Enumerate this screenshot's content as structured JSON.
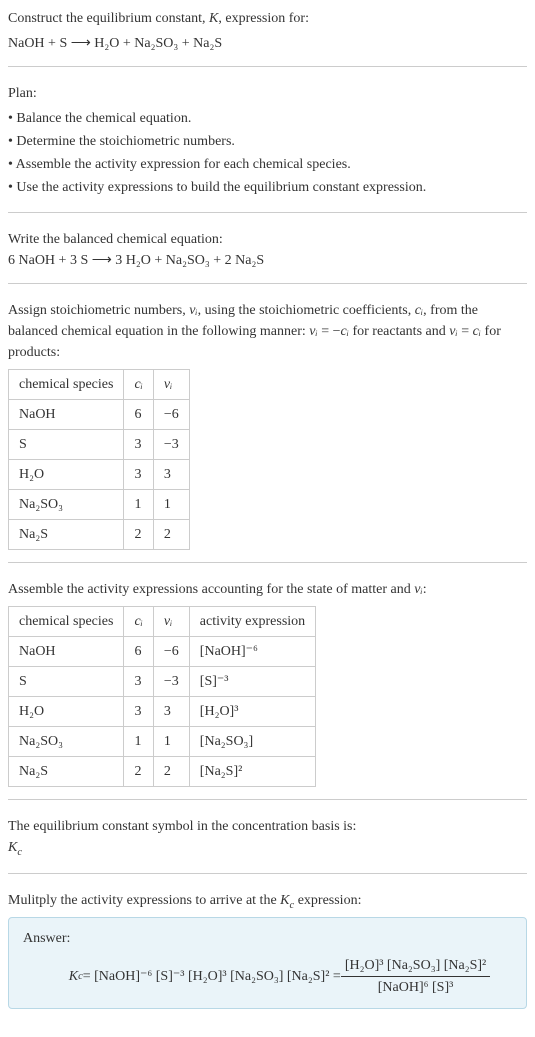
{
  "intro": {
    "line1": "Construct the equilibrium constant, ",
    "K": "K",
    "line1b": ", expression for:",
    "equation": "NaOH + S ⟶ H₂O + Na₂SO₃ + Na₂S"
  },
  "plan": {
    "title": "Plan:",
    "items": [
      "• Balance the chemical equation.",
      "• Determine the stoichiometric numbers.",
      "• Assemble the activity expression for each chemical species.",
      "• Use the activity expressions to build the equilibrium constant expression."
    ]
  },
  "balanced": {
    "title": "Write the balanced chemical equation:",
    "equation": "6 NaOH + 3 S ⟶ 3 H₂O + Na₂SO₃ + 2 Na₂S"
  },
  "stoich": {
    "intro1": "Assign stoichiometric numbers, ",
    "nu": "νᵢ",
    "intro2": ", using the stoichiometric coefficients, ",
    "ci": "cᵢ",
    "intro3": ", from the balanced chemical equation in the following manner: ",
    "rule1a": "νᵢ",
    "rule1b": " = −",
    "rule1c": "cᵢ",
    "intro4": " for reactants and ",
    "rule2a": "νᵢ",
    "rule2b": " = ",
    "rule2c": "cᵢ",
    "intro5": " for products:",
    "headers": [
      "chemical species",
      "cᵢ",
      "νᵢ"
    ],
    "rows": [
      {
        "species": "NaOH",
        "c": "6",
        "v": "−6"
      },
      {
        "species": "S",
        "c": "3",
        "v": "−3"
      },
      {
        "species": "H₂O",
        "c": "3",
        "v": "3"
      },
      {
        "species": "Na₂SO₃",
        "c": "1",
        "v": "1"
      },
      {
        "species": "Na₂S",
        "c": "2",
        "v": "2"
      }
    ]
  },
  "activity": {
    "intro1": "Assemble the activity expressions accounting for the state of matter and ",
    "nu": "νᵢ",
    "intro2": ":",
    "headers": [
      "chemical species",
      "cᵢ",
      "νᵢ",
      "activity expression"
    ],
    "rows": [
      {
        "species": "NaOH",
        "c": "6",
        "v": "−6",
        "expr": "[NaOH]⁻⁶"
      },
      {
        "species": "S",
        "c": "3",
        "v": "−3",
        "expr": "[S]⁻³"
      },
      {
        "species": "H₂O",
        "c": "3",
        "v": "3",
        "expr": "[H₂O]³"
      },
      {
        "species": "Na₂SO₃",
        "c": "1",
        "v": "1",
        "expr": "[Na₂SO₃]"
      },
      {
        "species": "Na₂S",
        "c": "2",
        "v": "2",
        "expr": "[Na₂S]²"
      }
    ]
  },
  "kcsymbol": {
    "line1": "The equilibrium constant symbol in the concentration basis is:",
    "Kc": "K",
    "Kc_sub": "c"
  },
  "final": {
    "title": "Mulitply the activity expressions to arrive at the ",
    "Kc": "K",
    "Kc_sub": "c",
    "title2": " expression:",
    "answer_label": "Answer:",
    "lhs": "K",
    "lhs_sub": "c",
    "eq": " = [NaOH]⁻⁶ [S]⁻³ [H₂O]³ [Na₂SO₃] [Na₂S]² = ",
    "num": "[H₂O]³ [Na₂SO₃] [Na₂S]²",
    "den": "[NaOH]⁶ [S]³"
  }
}
